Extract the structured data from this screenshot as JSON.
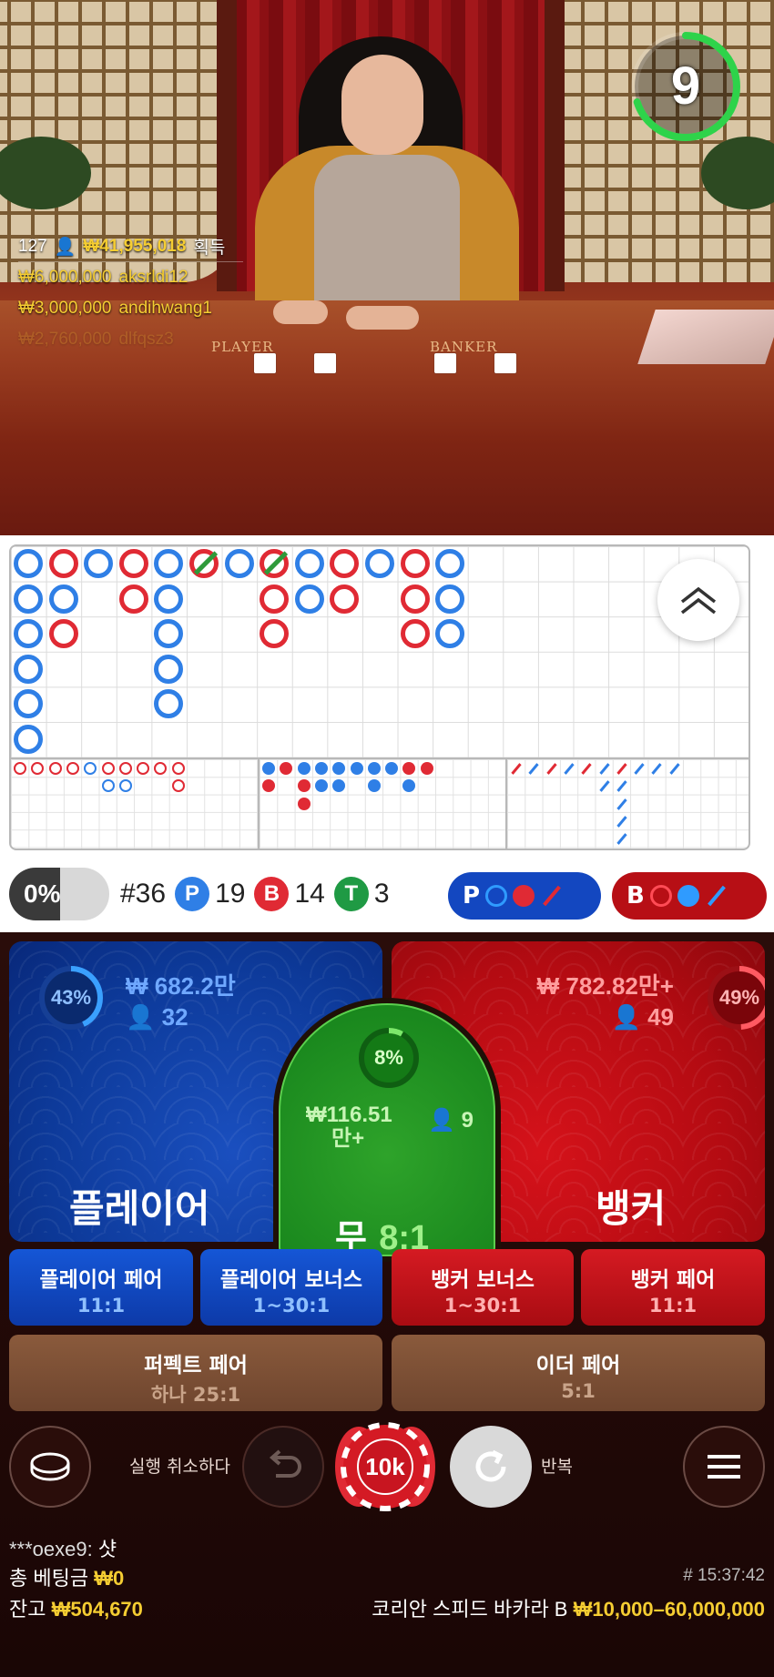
{
  "timer": {
    "value": "9",
    "progress": 0.7
  },
  "winners": {
    "header_count": "127",
    "header_amount": "₩41,955,018",
    "header_suffix": "획득",
    "rows": [
      {
        "amount": "₩6,000,000",
        "name": "aksrldi12"
      },
      {
        "amount": "₩3,000,000",
        "name": "andihwang1"
      },
      {
        "amount": "₩2,760,000",
        "name": "dlfqsz3"
      }
    ]
  },
  "table_labels": {
    "player": "PLAYER",
    "banker": "BANKER"
  },
  "stats": {
    "win_pct": "0%",
    "round": "#36",
    "player_letter": "P",
    "player_count": "19",
    "banker_letter": "B",
    "banker_count": "14",
    "tie_letter": "T",
    "tie_count": "3",
    "pred_player": "P",
    "pred_banker": "B"
  },
  "zones": {
    "player": {
      "pct": "43%",
      "pct_value": 43,
      "amount": "₩ 682.2만",
      "bettors": "32",
      "label": "플레이어"
    },
    "tie": {
      "pct": "8%",
      "pct_value": 8,
      "amount_line1": "116.51",
      "amount_line2": "만+",
      "currency": "₩",
      "bettors": "9",
      "label": "무",
      "odds": "8:1"
    },
    "banker": {
      "pct": "49%",
      "pct_value": 49,
      "amount": "₩ 782.82만+",
      "bettors": "49",
      "label": "뱅커"
    }
  },
  "side_bets": [
    {
      "title": "플레이어 페어",
      "odds": "11:1"
    },
    {
      "title": "플레이어 보너스",
      "odds": "1~30:1"
    },
    {
      "title": "뱅커 보너스",
      "odds": "1~30:1"
    },
    {
      "title": "뱅커 페어",
      "odds": "11:1"
    },
    {
      "title": "퍼펙트 페어",
      "odds": "하나 25:1"
    },
    {
      "title": "이더 페어",
      "odds": "5:1"
    }
  ],
  "controls": {
    "undo_label": "실행 취소하다",
    "chip": "10k",
    "repeat_label": "반복"
  },
  "chat": {
    "user": "***oexe9:",
    "message": "샷"
  },
  "footer": {
    "total_bet_label": "총 베팅금",
    "total_bet_value": "₩0",
    "balance_label": "잔고",
    "balance_value": "₩504,670",
    "time": "# 15:37:42",
    "table_name": "코리안 스피드 바카라 B",
    "limits": "₩10,000–60,000,000"
  },
  "colors": {
    "player": "#2f7fe6",
    "banker": "#e02a34",
    "tie": "#2e9a3a",
    "gold": "#f5cd32"
  },
  "bead_road": [
    [
      "P",
      "P",
      "P",
      "P",
      "P",
      "P"
    ],
    [
      "B",
      "P",
      "B"
    ],
    [
      "P"
    ],
    [
      "B",
      "B"
    ],
    [
      "P",
      "P",
      "P",
      "P",
      "P"
    ],
    [
      "BT"
    ],
    [
      "P"
    ],
    [
      "BT",
      "B",
      "B"
    ],
    [
      "P",
      "P"
    ],
    [
      "B",
      "B"
    ],
    [
      "P"
    ],
    [
      "B",
      "B",
      "B"
    ],
    [
      "P",
      "P",
      "P"
    ]
  ]
}
